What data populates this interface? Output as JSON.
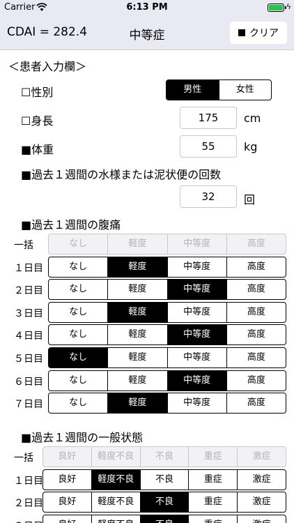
{
  "status": {
    "carrier": "Carrier",
    "time": "6:13 PM",
    "battery_color": "#26c64a"
  },
  "nav": {
    "score": "CDAI = 282.4",
    "severity": "中等症",
    "clear_label": "クリア"
  },
  "patient_header": "＜患者入力欄＞",
  "sex": {
    "label": "☐性別",
    "options": [
      "男性",
      "女性"
    ],
    "selected": 0
  },
  "height": {
    "label": "☐身長",
    "value": "175",
    "unit": "cm"
  },
  "weight": {
    "label": "■体重",
    "value": "55",
    "unit": "kg"
  },
  "stool": {
    "label": "■過去１週間の水様または泥状便の回数",
    "value": "32",
    "unit": "回"
  },
  "abdominal": {
    "label": "■過去１週間の腹痛",
    "options": [
      "なし",
      "軽度",
      "中等度",
      "高度"
    ],
    "bulk_label": "一括",
    "rows": [
      {
        "label": "１日目",
        "selected": 1
      },
      {
        "label": "２日目",
        "selected": 2
      },
      {
        "label": "３日目",
        "selected": 1
      },
      {
        "label": "４日目",
        "selected": 2
      },
      {
        "label": "５日目",
        "selected": 0
      },
      {
        "label": "６日目",
        "selected": 2
      },
      {
        "label": "７日目",
        "selected": 1
      }
    ]
  },
  "general": {
    "label": "■過去１週間の一般状態",
    "options": [
      "良好",
      "軽度不良",
      "不良",
      "重症",
      "激症"
    ],
    "bulk_label": "一括",
    "rows": [
      {
        "label": "１日目",
        "selected": 1
      },
      {
        "label": "２日目",
        "selected": 2
      },
      {
        "label": "３日目",
        "selected": 2
      }
    ]
  }
}
